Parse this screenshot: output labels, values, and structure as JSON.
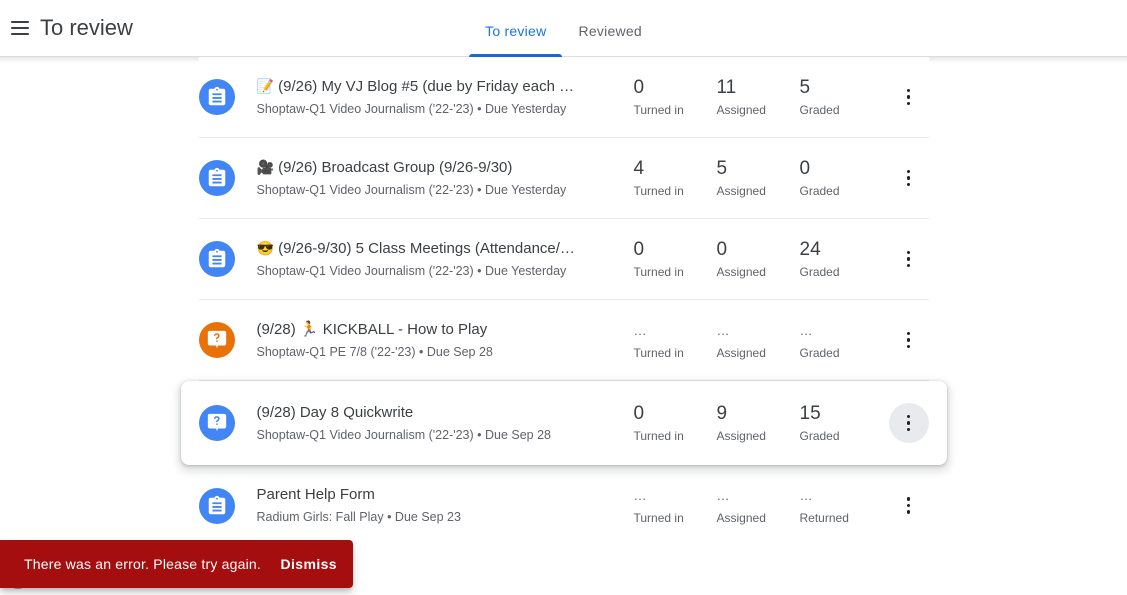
{
  "appbar": {
    "menu_icon": "hamburger-menu-icon",
    "title": "To review"
  },
  "tabs": [
    {
      "label": "To review",
      "active": true
    },
    {
      "label": "Reviewed",
      "active": false
    }
  ],
  "colors": {
    "accent_blue": "#1a73e8",
    "tab_underline": "#1967d2",
    "assignment_blue": "#4285f4",
    "question_orange": "#e8710a",
    "error_red": "#a50e0e",
    "divider": "#e8eaed"
  },
  "list": {
    "rows": [
      {
        "icon": "assignment-icon",
        "icon_color": "#4285f4",
        "emoji": "📝",
        "title": "(9/26) My VJ Blog #5 (due by Friday each w…",
        "subtitle": "Shoptaw-Q1 Video Journalism ('22-'23) • Due Yesterday",
        "stats": [
          {
            "value": "0",
            "label": "Turned in"
          },
          {
            "value": "11",
            "label": "Assigned"
          },
          {
            "value": "5",
            "label": "Graded"
          }
        ],
        "elevated": false,
        "menu_hovered": false
      },
      {
        "icon": "assignment-icon",
        "icon_color": "#4285f4",
        "emoji": "🎥",
        "title": "(9/26) Broadcast Group (9/26-9/30)",
        "subtitle": "Shoptaw-Q1 Video Journalism ('22-'23) • Due Yesterday",
        "stats": [
          {
            "value": "4",
            "label": "Turned in"
          },
          {
            "value": "5",
            "label": "Assigned"
          },
          {
            "value": "0",
            "label": "Graded"
          }
        ],
        "elevated": false,
        "menu_hovered": false
      },
      {
        "icon": "assignment-icon",
        "icon_color": "#4285f4",
        "emoji": "😎",
        "title": "(9/26-9/30) 5 Class Meetings (Attendance/…",
        "subtitle": "Shoptaw-Q1 Video Journalism ('22-'23) • Due Yesterday",
        "stats": [
          {
            "value": "0",
            "label": "Turned in"
          },
          {
            "value": "0",
            "label": "Assigned"
          },
          {
            "value": "24",
            "label": "Graded"
          }
        ],
        "elevated": false,
        "menu_hovered": false
      },
      {
        "icon": "question-icon",
        "icon_color": "#e8710a",
        "emoji": "",
        "title": "(9/28) 🏃 KICKBALL - How to Play",
        "subtitle": "Shoptaw-Q1 PE 7/8 ('22-'23) • Due Sep 28",
        "stats": [
          {
            "value": "…",
            "label": "Turned in"
          },
          {
            "value": "…",
            "label": "Assigned"
          },
          {
            "value": "…",
            "label": "Graded"
          }
        ],
        "elevated": false,
        "menu_hovered": false
      },
      {
        "icon": "question-icon",
        "icon_color": "#4285f4",
        "emoji": "",
        "title": "(9/28) Day 8 Quickwrite",
        "subtitle": "Shoptaw-Q1 Video Journalism ('22-'23) • Due Sep 28",
        "stats": [
          {
            "value": "0",
            "label": "Turned in"
          },
          {
            "value": "9",
            "label": "Assigned"
          },
          {
            "value": "15",
            "label": "Graded"
          }
        ],
        "elevated": true,
        "menu_hovered": true
      },
      {
        "icon": "assignment-icon",
        "icon_color": "#4285f4",
        "emoji": "",
        "title": "Parent Help Form",
        "subtitle": "Radium Girls: Fall Play • Due Sep 23",
        "stats": [
          {
            "value": "…",
            "label": "Turned in"
          },
          {
            "value": "…",
            "label": "Assigned"
          },
          {
            "value": "…",
            "label": "Returned"
          }
        ],
        "elevated": false,
        "menu_hovered": false
      }
    ]
  },
  "snackbar": {
    "message": "There was an error. Please try again.",
    "action_label": "Dismiss"
  },
  "help": {
    "icon": "help-question-icon",
    "label": "?"
  }
}
